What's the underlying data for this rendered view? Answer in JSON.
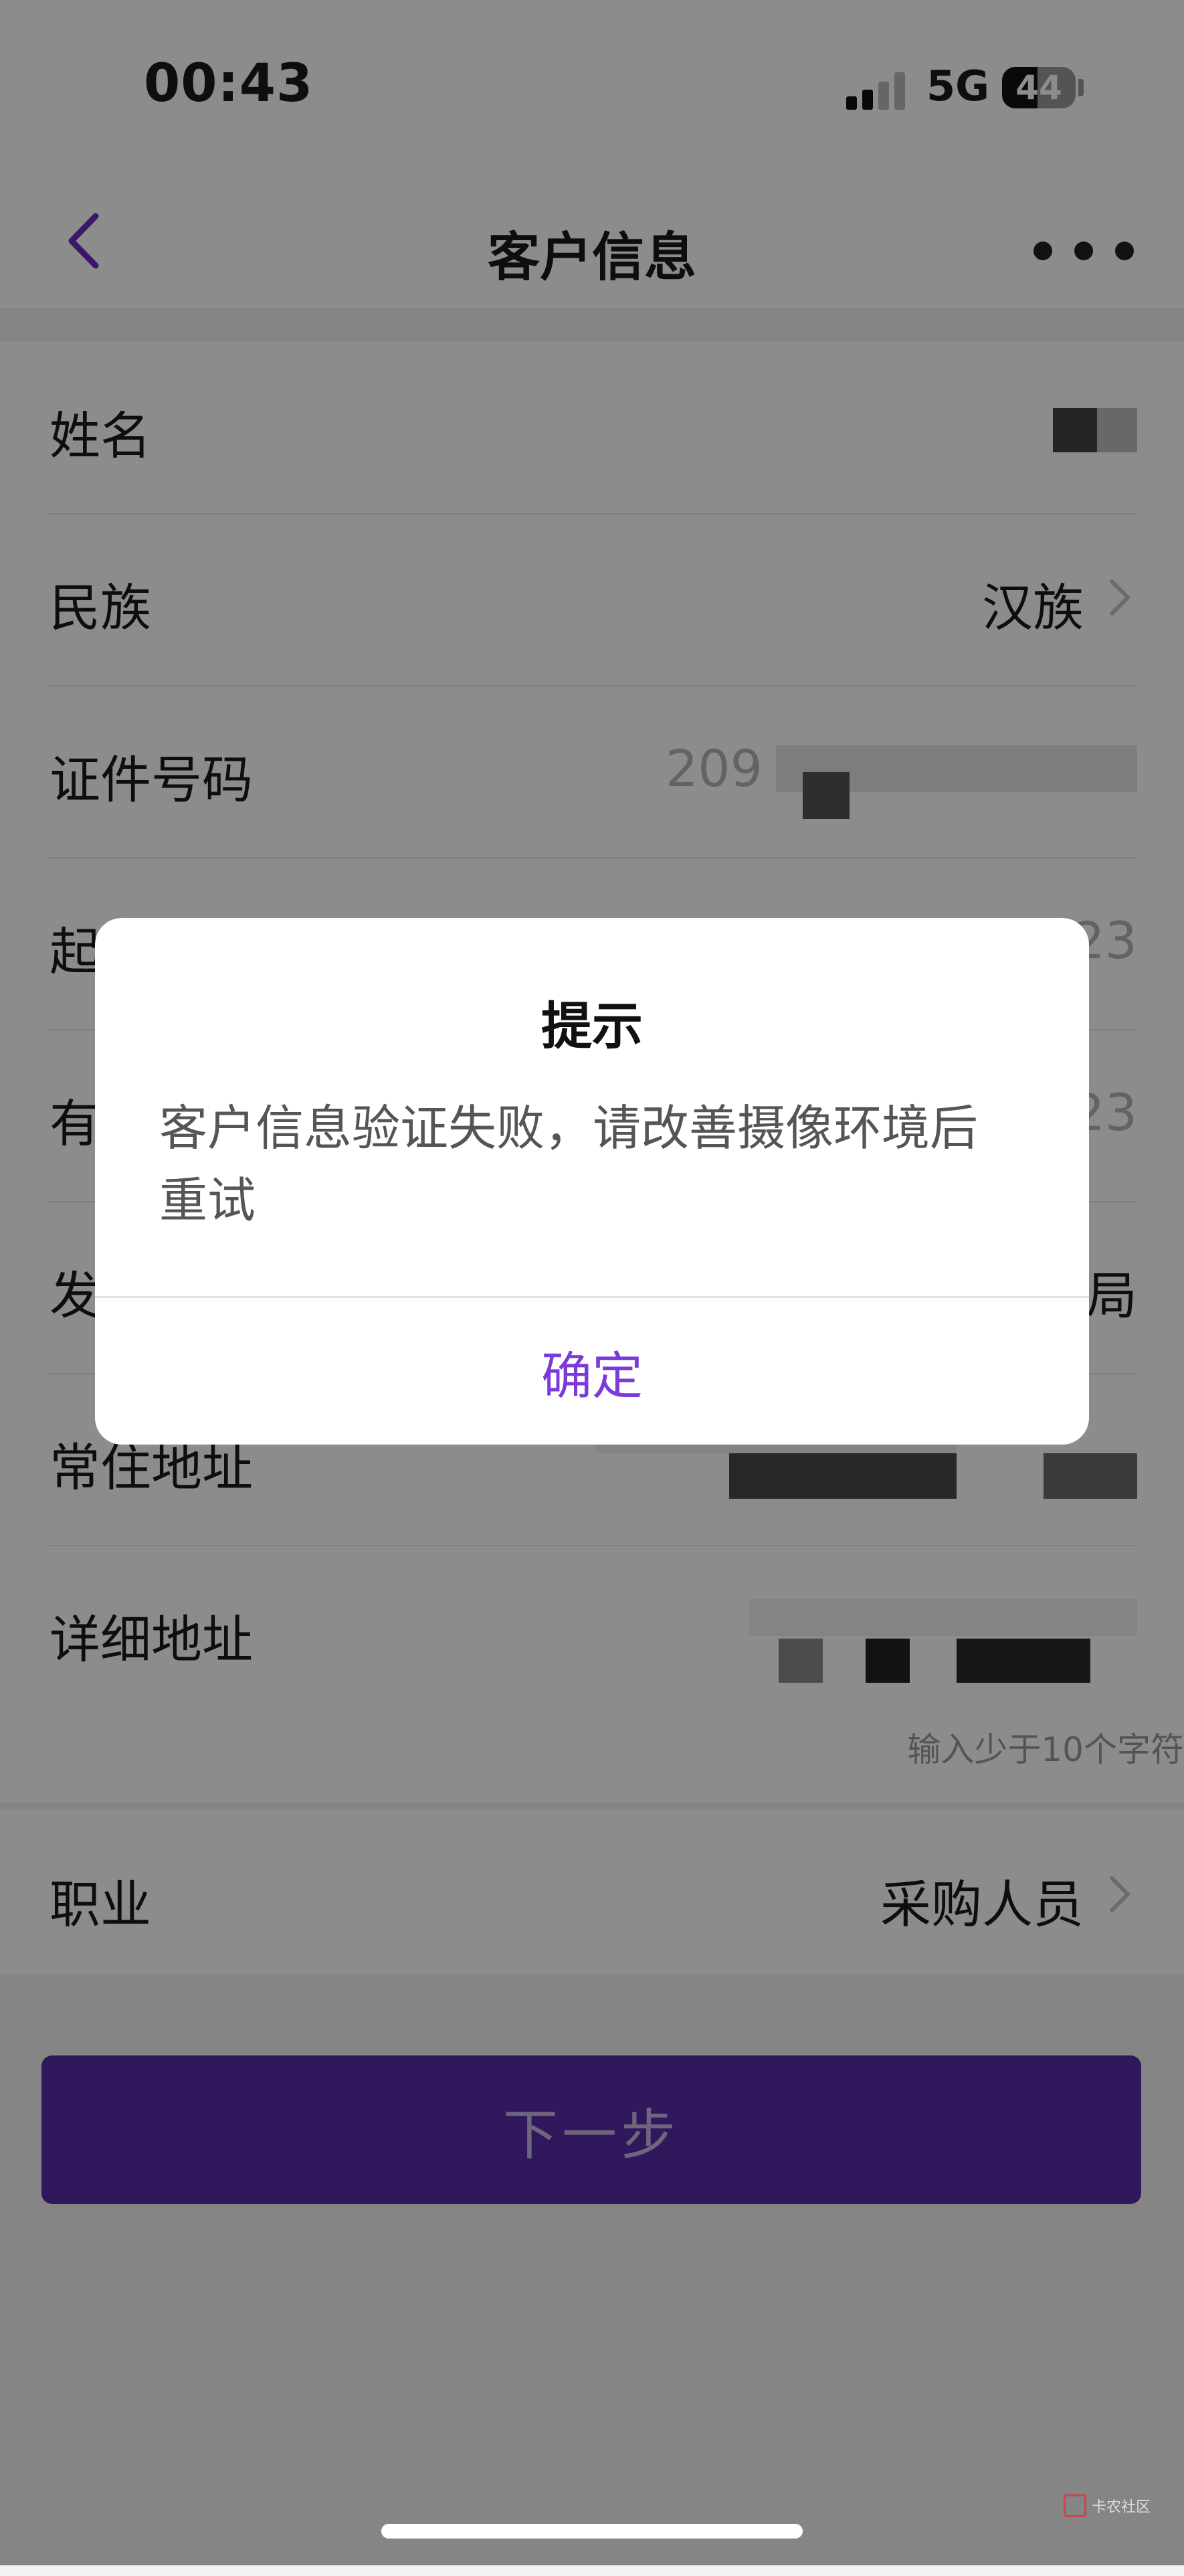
{
  "status_bar": {
    "time": "00:43",
    "network": "5G",
    "battery": "44"
  },
  "nav": {
    "title": "客户信息"
  },
  "form": {
    "rows": [
      {
        "label": "姓名",
        "value": ""
      },
      {
        "label": "民族",
        "value": "汉族"
      },
      {
        "label": "证件号码",
        "value": "209"
      },
      {
        "label": "起",
        "value": "23"
      },
      {
        "label": "有",
        "value": "23"
      },
      {
        "label": "发",
        "value": "局"
      },
      {
        "label": "常住地址",
        "value": ""
      },
      {
        "label": "详细地址",
        "value": ""
      }
    ],
    "address_hint": "输入少于10个字符",
    "job": {
      "label": "职业",
      "value": "采购人员"
    }
  },
  "next_button": "下一步",
  "dialog": {
    "title": "提示",
    "message": "客户信息验证失败，请改善摄像环境后重试",
    "confirm": "确定"
  },
  "watermark": "卡农社区"
}
